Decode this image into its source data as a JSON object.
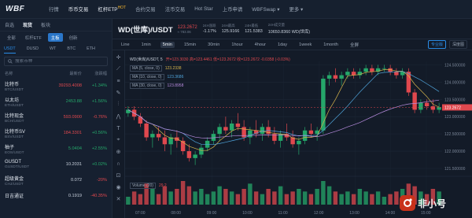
{
  "nav": {
    "logo": "WBF",
    "items": [
      {
        "label": "行情",
        "state": "normal"
      },
      {
        "label": "币币交易",
        "state": "active"
      },
      {
        "label": "杠杆ETP",
        "state": "hot",
        "badge": "HOT"
      },
      {
        "label": "合约交易",
        "state": "normal"
      },
      {
        "label": "法币交易",
        "state": "normal"
      },
      {
        "label": "Hot Star",
        "state": "normal"
      },
      {
        "label": "上币申请",
        "state": "normal"
      },
      {
        "label": "WBFSwap ▾",
        "state": "normal"
      },
      {
        "label": "更多 ▾",
        "state": "normal"
      }
    ]
  },
  "sidebar": {
    "tabs": [
      "自选",
      "现货",
      "板块"
    ],
    "active_tab": "现货",
    "sub_chips": [
      "全部",
      "杠杆ETF",
      "主板",
      "创新"
    ],
    "active_chip": "主板",
    "quote_tabs": [
      "USDT",
      "DUSD",
      "WT",
      "BTC",
      "ETH"
    ],
    "active_quote": "USDT",
    "search_placeholder": "搜索币种",
    "headers": {
      "name": "名称",
      "price": "最新价",
      "change": "涨跌幅"
    },
    "rows": [
      {
        "name": "比特币",
        "pair": "BTC/USDT",
        "price": "39293.4008",
        "change": "+1.34%",
        "dir": "down",
        "cdir": "up"
      },
      {
        "name": "以太坊",
        "pair": "ETH/USDT",
        "price": "2453.88",
        "change": "+1.56%",
        "dir": "up",
        "cdir": "up"
      },
      {
        "name": "比特现金",
        "pair": "BCH/USDT",
        "price": "593.0900",
        "change": "-0.76%",
        "dir": "down",
        "cdir": "down"
      },
      {
        "name": "比特币SV",
        "pair": "BSV/USDT",
        "price": "184.3301",
        "change": "+0.56%",
        "dir": "down",
        "cdir": "up"
      },
      {
        "name": "柚子",
        "pair": "EOS/USDT",
        "price": "5.0404",
        "change": "+2.55%",
        "dir": "up",
        "cdir": "up"
      },
      {
        "name": "GUSDT",
        "pair": "GUSDT/USDT",
        "price": "10.2031",
        "change": "+0.02%",
        "dir": "plain",
        "cdir": "up"
      },
      {
        "name": "超级黄金",
        "pair": "CHJ/USDT",
        "price": "0.072",
        "change": "-20%",
        "dir": "plain",
        "cdir": "down"
      },
      {
        "name": "日吉通证",
        "pair": "",
        "price": "0.1919",
        "change": "-40.35%",
        "dir": "plain",
        "cdir": "down"
      }
    ]
  },
  "header": {
    "title": "WD(世库)/USDT",
    "stats": [
      {
        "label": "123.2672",
        "value": "≈ 783.06",
        "big": true
      },
      {
        "label": "24H涨跌",
        "value": "-1.17%"
      },
      {
        "label": "24H最高",
        "value": "125.9166"
      },
      {
        "label": "24H最低",
        "value": "121.5383"
      },
      {
        "label": "24H成交量",
        "value": "10650.8360 WD(世库)"
      }
    ]
  },
  "timeframes": {
    "items": [
      "Line",
      "1min",
      "5min",
      "15min",
      "30min",
      "1hour",
      "4hour",
      "1day",
      "1week",
      "1month",
      "全屏"
    ],
    "active": "5min",
    "right_pills": [
      "专业版",
      "深度图"
    ]
  },
  "legends": {
    "main": "WD(世库)/USDT, 5",
    "ohlc": "开=123.3030  高=123.4461  低=123.2672  收=123.2672  -0.0358 (-0.03%)",
    "ma5": "MA (5, close, 0)",
    "ma5_val": "123.2338",
    "ma10": "MA (10, close, 0)",
    "ma10_val": "123.3686",
    "ma30": "MA (30, close, 0)",
    "ma30_val": "123.8958",
    "volume": "Volume (20)",
    "volume_val": "29.2"
  },
  "chart_data": {
    "type": "candlestick",
    "ylim": [
      121.5,
      124.6
    ],
    "y_ticks": [
      "124.500000",
      "124.000000",
      "123.500000",
      "123.000000",
      "122.500000",
      "122.000000",
      "121.500000"
    ],
    "last_price_label": "123.2672",
    "x_ticks": [
      "07:00",
      "08:00",
      "09:00",
      "10:00",
      "11:00",
      "12:00",
      "13:00",
      "14:00",
      "15:00"
    ],
    "candles": [
      [
        123.1,
        123.3,
        123.0,
        123.2
      ],
      [
        123.2,
        123.3,
        122.9,
        123.0
      ],
      [
        123.0,
        123.1,
        122.7,
        122.8
      ],
      [
        122.8,
        122.9,
        122.3,
        122.4
      ],
      [
        122.4,
        122.6,
        122.1,
        122.5
      ],
      [
        122.5,
        122.7,
        122.3,
        122.4
      ],
      [
        122.4,
        122.6,
        122.0,
        122.2
      ],
      [
        122.2,
        122.5,
        121.9,
        122.4
      ],
      [
        122.4,
        122.6,
        122.1,
        122.3
      ],
      [
        122.3,
        122.4,
        121.9,
        122.0
      ],
      [
        122.0,
        122.2,
        121.7,
        121.8
      ],
      [
        121.8,
        122.0,
        121.6,
        121.9
      ],
      [
        121.9,
        122.2,
        121.8,
        122.1
      ],
      [
        122.1,
        122.4,
        122.0,
        122.3
      ],
      [
        122.3,
        122.6,
        122.2,
        122.5
      ],
      [
        122.5,
        122.8,
        122.3,
        122.7
      ],
      [
        122.7,
        123.0,
        122.5,
        122.6
      ],
      [
        122.6,
        122.9,
        122.4,
        122.8
      ],
      [
        122.8,
        123.1,
        122.6,
        122.7
      ],
      [
        122.7,
        122.9,
        122.3,
        122.4
      ],
      [
        122.4,
        122.7,
        122.2,
        122.6
      ],
      [
        122.6,
        122.9,
        122.4,
        122.5
      ],
      [
        122.5,
        122.8,
        122.3,
        122.7
      ],
      [
        122.7,
        122.9,
        122.4,
        122.5
      ],
      [
        122.5,
        122.7,
        122.2,
        122.3
      ],
      [
        122.3,
        122.6,
        122.1,
        122.5
      ],
      [
        122.5,
        122.8,
        122.3,
        122.4
      ],
      [
        122.4,
        122.6,
        122.1,
        122.2
      ],
      [
        122.2,
        122.4,
        121.9,
        122.3
      ],
      [
        122.3,
        122.7,
        122.2,
        122.6
      ],
      [
        122.6,
        122.8,
        122.4,
        122.5
      ],
      [
        122.5,
        122.7,
        122.3,
        122.6
      ],
      [
        122.6,
        124.2,
        122.5,
        124.1
      ],
      [
        124.1,
        124.3,
        123.9,
        124.2
      ],
      [
        124.2,
        124.4,
        124.0,
        124.1
      ],
      [
        124.1,
        124.3,
        123.9,
        124.2
      ],
      [
        124.2,
        124.4,
        124.1,
        124.3
      ],
      [
        124.3,
        124.4,
        124.1,
        124.2
      ],
      [
        124.2,
        124.4,
        124.1,
        124.3
      ],
      [
        124.3,
        124.5,
        124.2,
        124.4
      ],
      [
        124.4,
        124.5,
        124.2,
        124.3
      ],
      [
        124.3,
        124.5,
        124.2,
        124.4
      ],
      [
        124.4,
        124.5,
        124.3,
        124.4
      ],
      [
        124.4,
        124.5,
        124.2,
        124.3
      ],
      [
        124.3,
        124.4,
        124.1,
        124.2
      ],
      [
        124.2,
        124.4,
        124.1,
        124.3
      ],
      [
        124.3,
        124.4,
        123.6,
        123.7
      ],
      [
        123.7,
        123.8,
        123.1,
        123.2
      ],
      [
        123.2,
        123.5,
        123.1,
        123.4
      ],
      [
        123.4,
        123.5,
        123.2,
        123.3
      ],
      [
        123.3,
        123.5,
        123.1,
        123.2
      ],
      [
        123.2,
        123.4,
        123.1,
        123.27
      ]
    ],
    "volumes": [
      3,
      5,
      4,
      8,
      6,
      4,
      7,
      5,
      6,
      9,
      7,
      5,
      6,
      4,
      5,
      7,
      6,
      5,
      4,
      6,
      8,
      5,
      4,
      6,
      5,
      7,
      4,
      5,
      6,
      5,
      4,
      6,
      9,
      7,
      5,
      4,
      5,
      4,
      6,
      5,
      4,
      5,
      3,
      4,
      5,
      6,
      8,
      7,
      5,
      4,
      6,
      5
    ]
  },
  "watermark": {
    "text": "非小号"
  },
  "colors": {
    "up": "#25a76a",
    "down": "#e0484e",
    "ma5": "#d5b34c",
    "ma10": "#4fa3d9",
    "ma30": "#b98de0"
  }
}
